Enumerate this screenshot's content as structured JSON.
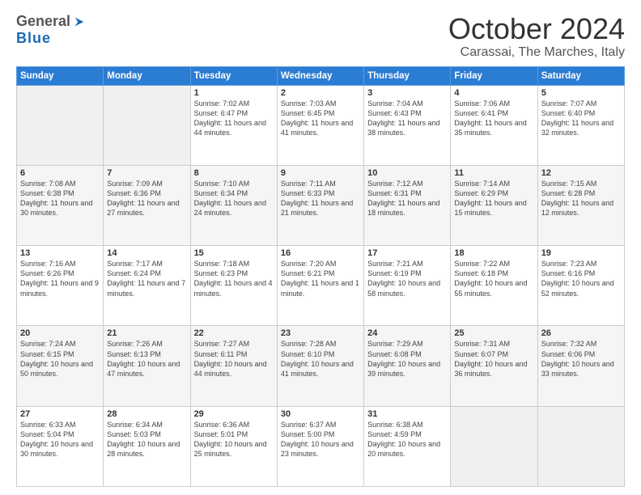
{
  "header": {
    "logo_general": "General",
    "logo_blue": "Blue",
    "month_title": "October 2024",
    "location": "Carassai, The Marches, Italy"
  },
  "days_of_week": [
    "Sunday",
    "Monday",
    "Tuesday",
    "Wednesday",
    "Thursday",
    "Friday",
    "Saturday"
  ],
  "weeks": [
    [
      {
        "day": "",
        "info": ""
      },
      {
        "day": "",
        "info": ""
      },
      {
        "day": "1",
        "info": "Sunrise: 7:02 AM\nSunset: 6:47 PM\nDaylight: 11 hours and 44 minutes."
      },
      {
        "day": "2",
        "info": "Sunrise: 7:03 AM\nSunset: 6:45 PM\nDaylight: 11 hours and 41 minutes."
      },
      {
        "day": "3",
        "info": "Sunrise: 7:04 AM\nSunset: 6:43 PM\nDaylight: 11 hours and 38 minutes."
      },
      {
        "day": "4",
        "info": "Sunrise: 7:06 AM\nSunset: 6:41 PM\nDaylight: 11 hours and 35 minutes."
      },
      {
        "day": "5",
        "info": "Sunrise: 7:07 AM\nSunset: 6:40 PM\nDaylight: 11 hours and 32 minutes."
      }
    ],
    [
      {
        "day": "6",
        "info": "Sunrise: 7:08 AM\nSunset: 6:38 PM\nDaylight: 11 hours and 30 minutes."
      },
      {
        "day": "7",
        "info": "Sunrise: 7:09 AM\nSunset: 6:36 PM\nDaylight: 11 hours and 27 minutes."
      },
      {
        "day": "8",
        "info": "Sunrise: 7:10 AM\nSunset: 6:34 PM\nDaylight: 11 hours and 24 minutes."
      },
      {
        "day": "9",
        "info": "Sunrise: 7:11 AM\nSunset: 6:33 PM\nDaylight: 11 hours and 21 minutes."
      },
      {
        "day": "10",
        "info": "Sunrise: 7:12 AM\nSunset: 6:31 PM\nDaylight: 11 hours and 18 minutes."
      },
      {
        "day": "11",
        "info": "Sunrise: 7:14 AM\nSunset: 6:29 PM\nDaylight: 11 hours and 15 minutes."
      },
      {
        "day": "12",
        "info": "Sunrise: 7:15 AM\nSunset: 6:28 PM\nDaylight: 11 hours and 12 minutes."
      }
    ],
    [
      {
        "day": "13",
        "info": "Sunrise: 7:16 AM\nSunset: 6:26 PM\nDaylight: 11 hours and 9 minutes."
      },
      {
        "day": "14",
        "info": "Sunrise: 7:17 AM\nSunset: 6:24 PM\nDaylight: 11 hours and 7 minutes."
      },
      {
        "day": "15",
        "info": "Sunrise: 7:18 AM\nSunset: 6:23 PM\nDaylight: 11 hours and 4 minutes."
      },
      {
        "day": "16",
        "info": "Sunrise: 7:20 AM\nSunset: 6:21 PM\nDaylight: 11 hours and 1 minute."
      },
      {
        "day": "17",
        "info": "Sunrise: 7:21 AM\nSunset: 6:19 PM\nDaylight: 10 hours and 58 minutes."
      },
      {
        "day": "18",
        "info": "Sunrise: 7:22 AM\nSunset: 6:18 PM\nDaylight: 10 hours and 55 minutes."
      },
      {
        "day": "19",
        "info": "Sunrise: 7:23 AM\nSunset: 6:16 PM\nDaylight: 10 hours and 52 minutes."
      }
    ],
    [
      {
        "day": "20",
        "info": "Sunrise: 7:24 AM\nSunset: 6:15 PM\nDaylight: 10 hours and 50 minutes."
      },
      {
        "day": "21",
        "info": "Sunrise: 7:26 AM\nSunset: 6:13 PM\nDaylight: 10 hours and 47 minutes."
      },
      {
        "day": "22",
        "info": "Sunrise: 7:27 AM\nSunset: 6:11 PM\nDaylight: 10 hours and 44 minutes."
      },
      {
        "day": "23",
        "info": "Sunrise: 7:28 AM\nSunset: 6:10 PM\nDaylight: 10 hours and 41 minutes."
      },
      {
        "day": "24",
        "info": "Sunrise: 7:29 AM\nSunset: 6:08 PM\nDaylight: 10 hours and 39 minutes."
      },
      {
        "day": "25",
        "info": "Sunrise: 7:31 AM\nSunset: 6:07 PM\nDaylight: 10 hours and 36 minutes."
      },
      {
        "day": "26",
        "info": "Sunrise: 7:32 AM\nSunset: 6:06 PM\nDaylight: 10 hours and 33 minutes."
      }
    ],
    [
      {
        "day": "27",
        "info": "Sunrise: 6:33 AM\nSunset: 5:04 PM\nDaylight: 10 hours and 30 minutes."
      },
      {
        "day": "28",
        "info": "Sunrise: 6:34 AM\nSunset: 5:03 PM\nDaylight: 10 hours and 28 minutes."
      },
      {
        "day": "29",
        "info": "Sunrise: 6:36 AM\nSunset: 5:01 PM\nDaylight: 10 hours and 25 minutes."
      },
      {
        "day": "30",
        "info": "Sunrise: 6:37 AM\nSunset: 5:00 PM\nDaylight: 10 hours and 23 minutes."
      },
      {
        "day": "31",
        "info": "Sunrise: 6:38 AM\nSunset: 4:59 PM\nDaylight: 10 hours and 20 minutes."
      },
      {
        "day": "",
        "info": ""
      },
      {
        "day": "",
        "info": ""
      }
    ]
  ]
}
